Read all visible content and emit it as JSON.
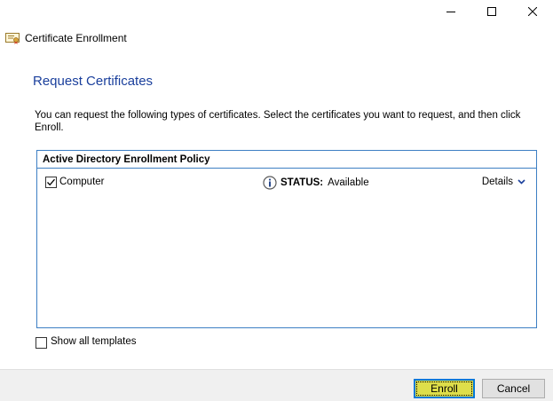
{
  "window": {
    "title": "Certificate Enrollment",
    "controls": [
      "minimize",
      "maximize",
      "close"
    ]
  },
  "page": {
    "heading": "Request Certificates",
    "description": "You can request the following types of certificates. Select the certificates you want to request, and then click Enroll."
  },
  "policy": {
    "header": "Active Directory Enrollment Policy",
    "certificates": [
      {
        "name": "Computer",
        "checked": true,
        "status_label": "STATUS:",
        "status_value": "Available",
        "details_label": "Details"
      }
    ]
  },
  "show_all": {
    "label": "Show all templates",
    "checked": false
  },
  "footer": {
    "enroll_label": "Enroll",
    "cancel_label": "Cancel",
    "enroll_highlight": "#dede4a",
    "focus_border": "#0078d7"
  },
  "colors": {
    "heading": "#1a3f9c",
    "box_border": "#3d7fc4",
    "footer_bg": "#f0f0f0"
  }
}
